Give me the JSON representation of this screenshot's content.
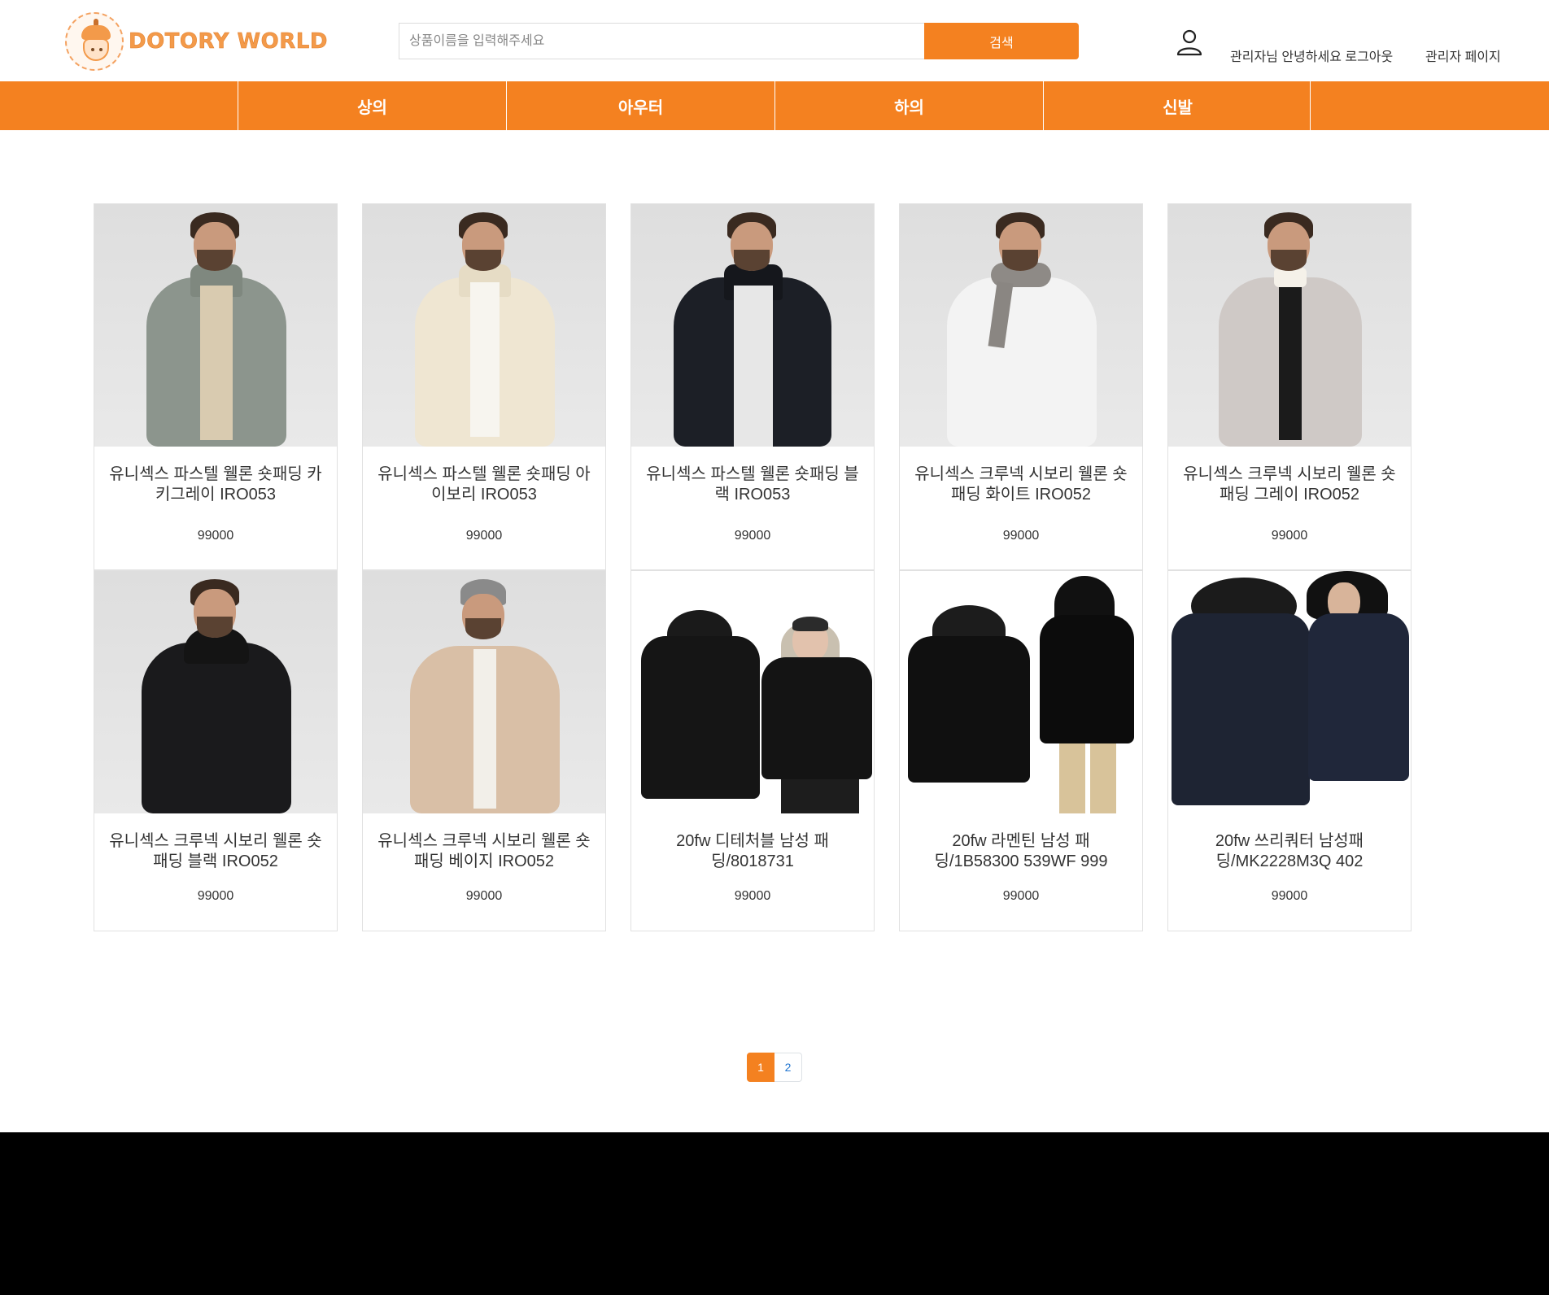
{
  "header": {
    "logo_text": "DOTORY WORLD",
    "search_placeholder": "상품이름을 입력해주세요",
    "search_button": "검색",
    "greeting": "관리자님 안녕하세요 로그아웃",
    "admin_link": "관리자 페이지"
  },
  "nav": {
    "items": [
      {
        "label": "상의"
      },
      {
        "label": "아우터"
      },
      {
        "label": "하의"
      },
      {
        "label": "신발"
      }
    ]
  },
  "products": [
    {
      "name": "유니섹스 파스텔 웰론 숏패딩 카키그레이 IRO053",
      "price": "99000",
      "color": "#8c958d"
    },
    {
      "name": "유니섹스 파스텔 웰론 숏패딩 아이보리 IRO053",
      "price": "99000",
      "color": "#efe6d2"
    },
    {
      "name": "유니섹스 파스텔 웰론 숏패딩 블랙 IRO053",
      "price": "99000",
      "color": "#1c1f26"
    },
    {
      "name": "유니섹스 크루넥 시보리 웰론 숏패딩 화이트 IRO052",
      "price": "99000",
      "color": "#f3f3f3"
    },
    {
      "name": "유니섹스 크루넥 시보리 웰론 숏패딩 그레이 IRO052",
      "price": "99000",
      "color": "#cfc9c6"
    },
    {
      "name": "유니섹스 크루넥 시보리 웰론 숏패딩 블랙 IRO052",
      "price": "99000",
      "color": "#1a1a1c"
    },
    {
      "name": "유니섹스 크루넥 시보리 웰론 숏패딩 베이지 IRO052",
      "price": "99000",
      "color": "#d9bfa6"
    },
    {
      "name": "20fw 디테처블 남성 패딩/8018731",
      "price": "99000",
      "color": "#151515"
    },
    {
      "name": "20fw 라멘틴 남성 패딩/1B58300 539WF 999",
      "price": "99000",
      "color": "#101010"
    },
    {
      "name": "20fw 쓰리쿼터 남성패딩/MK2228M3Q 402",
      "price": "99000",
      "color": "#1e2433"
    }
  ],
  "pagination": {
    "pages": [
      "1",
      "2"
    ],
    "current": "1"
  },
  "colors": {
    "accent": "#f48120",
    "footer": "#000000"
  }
}
